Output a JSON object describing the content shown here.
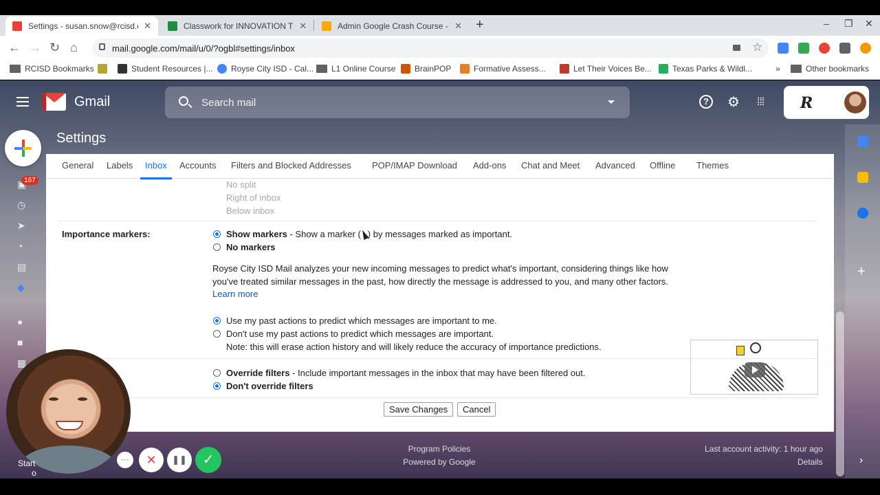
{
  "browser": {
    "tabs": [
      {
        "title": "Settings - susan.snow@rcisd.org",
        "close": "✕"
      },
      {
        "title": "Classwork for INNOVATION TEA",
        "close": "✕"
      },
      {
        "title": "Admin Google Crash Course - G",
        "close": "✕"
      }
    ],
    "new_tab": "+",
    "url": "mail.google.com/mail/u/0/?ogbl#settings/inbox",
    "bookmarks": [
      "RCISD Bookmarks",
      "Student Resources |...",
      "Royse City ISD - Cal...",
      "L1 Online Course",
      "BrainPOP",
      "Formative Assess...",
      "Let Their Voices Be...",
      "Texas Parks & Wildl...",
      "»",
      "Other bookmarks"
    ]
  },
  "gmail": {
    "app_name": "Gmail",
    "search_placeholder": "Search mail",
    "help_glyph": "?",
    "unread_count": "167",
    "account_logo": "R"
  },
  "settings": {
    "title": "Settings",
    "tabs": [
      "General",
      "Labels",
      "Inbox",
      "Accounts",
      "Filters and Blocked Addresses",
      "POP/IMAP Download",
      "Add-ons",
      "Chat and Meet",
      "Advanced",
      "Offline",
      "Themes"
    ],
    "active_tab": "Inbox",
    "reading_pane": [
      "No split",
      "Right of inbox",
      "Below inbox"
    ],
    "importance_label": "Importance markers:",
    "show_markers_bold": "Show markers",
    "show_markers_rest": " - Show a marker (",
    "show_markers_end": ") by messages marked as important.",
    "no_markers": "No markers",
    "description": "Royse City ISD Mail analyzes your new incoming messages to predict what's important, considering things like how you've treated similar messages in the past, how directly the message is addressed to you, and many other factors. ",
    "learn_more": "Learn more",
    "use_past": "Use my past actions to predict which messages are important to me.",
    "dont_use_past": "Don't use my past actions to predict which messages are important.",
    "dont_use_note": "Note: this will erase action history and will likely reduce the accuracy of importance predictions.",
    "override_bold": "Override filters",
    "override_rest": " - Include important messages in the inbox that may have been filtered out.",
    "dont_override": "Don't override filters",
    "save": "Save Changes",
    "cancel": "Cancel"
  },
  "footer": {
    "policies": "Program Policies",
    "powered": "Powered by Google",
    "activity": "Last account activity: 1 hour ago",
    "details": "Details"
  },
  "overlay": {
    "start_label": "Start",
    "start_sub": "o",
    "more": "···",
    "cancel": "✕",
    "pause": "❚❚",
    "done": "✓"
  },
  "colors": {
    "accent": "#1a73e8",
    "gmail_red": "#ea4335",
    "badge": "#d93025"
  }
}
